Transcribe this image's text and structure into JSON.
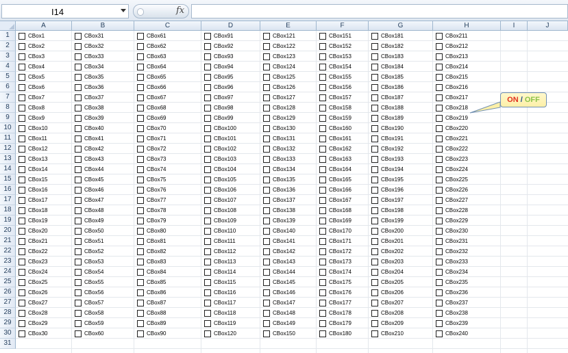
{
  "name_box": {
    "value": "I14"
  },
  "formula_bar": {
    "fx_label": "fx",
    "value": ""
  },
  "columns": [
    "A",
    "B",
    "C",
    "D",
    "E",
    "F",
    "G",
    "H",
    "I",
    "J"
  ],
  "rows": [
    "1",
    "2",
    "3",
    "4",
    "5",
    "6",
    "7",
    "8",
    "9",
    "10",
    "11",
    "12",
    "13",
    "14",
    "15",
    "16",
    "17",
    "18",
    "19",
    "20",
    "21",
    "22",
    "23",
    "24",
    "25",
    "26",
    "27",
    "28",
    "29",
    "30",
    "31"
  ],
  "checkbox_prefix": "CBox",
  "checkbox_columns": [
    {
      "column": "A",
      "start": 1
    },
    {
      "column": "B",
      "start": 31
    },
    {
      "column": "C",
      "start": 61
    },
    {
      "column": "D",
      "start": 91
    },
    {
      "column": "E",
      "start": 121
    },
    {
      "column": "F",
      "start": 151
    },
    {
      "column": "G",
      "start": 181
    },
    {
      "column": "H",
      "start": 211
    }
  ],
  "checkbox_rows": 30,
  "callout": {
    "on": "ON",
    "separator": "/",
    "off": "OFF"
  },
  "colors": {
    "header_bg": "#dbe5f1",
    "on": "#e03020",
    "off": "#8bc34a",
    "callout_bg": "#fdf0a8"
  }
}
